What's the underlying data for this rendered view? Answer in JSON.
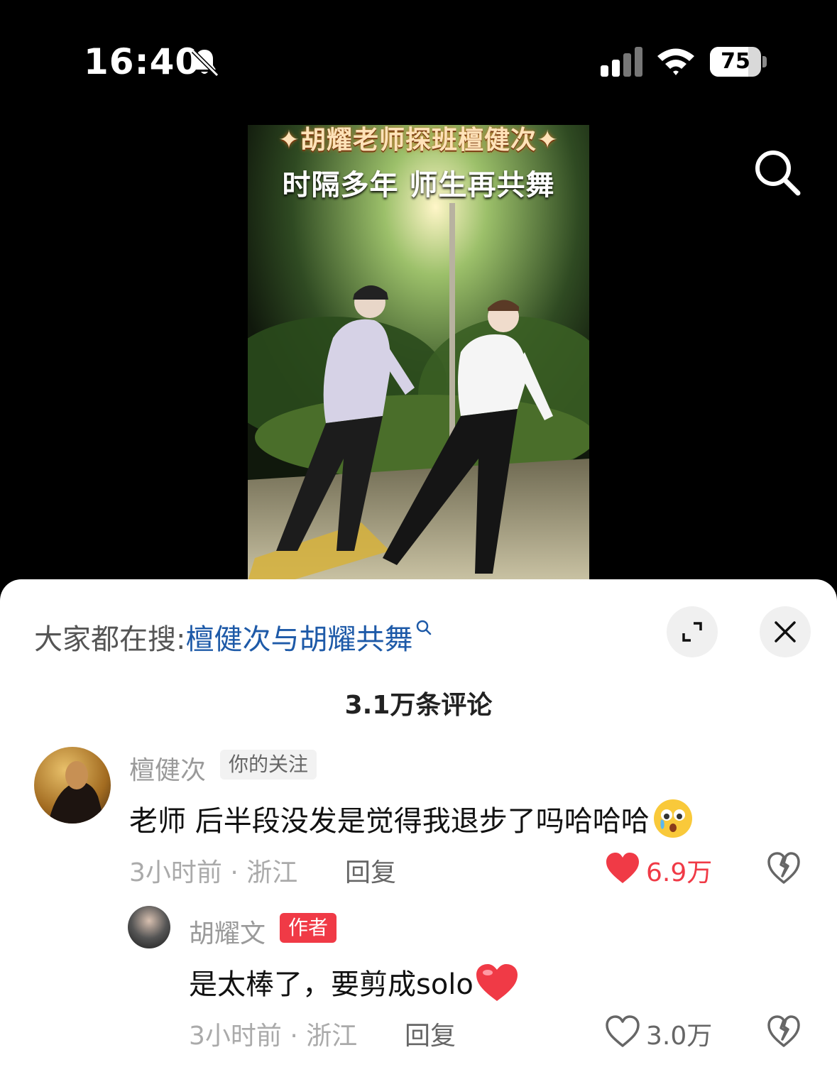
{
  "status_bar": {
    "time": "16:40",
    "battery": "75",
    "battery_level": 0.75
  },
  "video": {
    "title": "✦胡耀老师探班檀健次✦",
    "subtitle": "时隔多年 师生再共舞"
  },
  "panel": {
    "hot_search_prefix": "大家都在搜:",
    "hot_search_term": "檀健次与胡耀共舞",
    "comment_count": "3.1万条评论"
  },
  "comments": [
    {
      "user": "檀健次",
      "tag": "你的关注",
      "text": "老师 后半段没发是觉得我退步了吗哈哈哈",
      "meta": "3小时前 · 浙江",
      "reply": "回复",
      "likes": "6.9万",
      "liked": true
    },
    {
      "user": "胡耀文",
      "tag": "作者",
      "text": "是太棒了，要剪成solo",
      "meta": "3小时前 · 浙江",
      "reply": "回复",
      "likes": "3.0万",
      "liked": false
    }
  ],
  "colors": {
    "accent": "#f03a46",
    "link": "#1e5aa8"
  },
  "icons": [
    "bell-off-icon",
    "signal-icon",
    "wifi-icon",
    "battery-icon",
    "search-icon",
    "expand-icon",
    "close-icon",
    "heart-icon",
    "dislike-icon"
  ]
}
